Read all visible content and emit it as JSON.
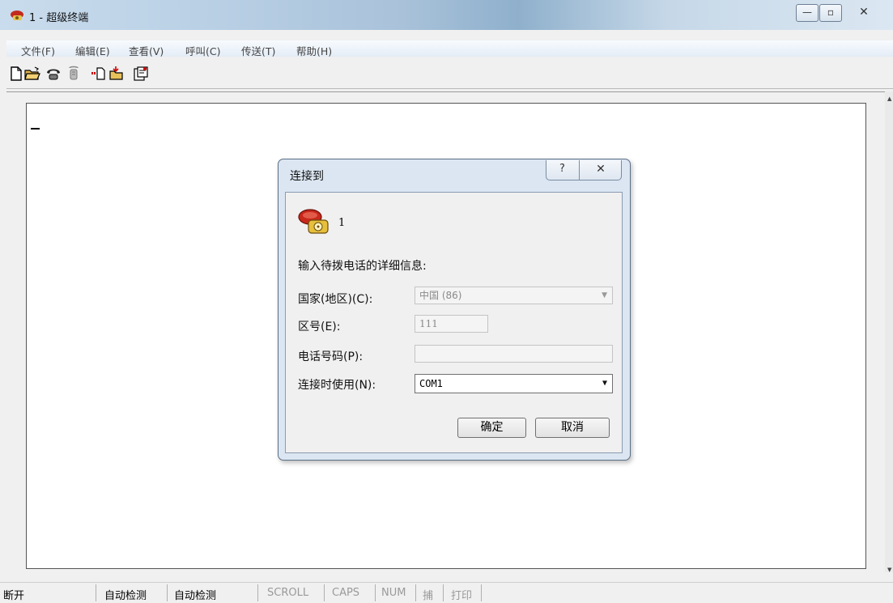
{
  "window": {
    "title": "1 - 超级终端"
  },
  "menu": [
    "文件(F)",
    "编辑(E)",
    "查看(V)",
    "呼叫(C)",
    "传送(T)",
    "帮助(H)"
  ],
  "toolbar_icons": [
    "new-icon",
    "open-icon",
    "dial-icon",
    "hangup-icon",
    "send-icon",
    "receive-icon",
    "properties-icon"
  ],
  "dialog": {
    "title": "连接到",
    "help_glyph": "?",
    "close_glyph": "✕",
    "connection_name": "1",
    "prompt": "输入待拨电话的详细信息:",
    "country_label": "国家(地区)(C):",
    "country_value": "中国 (86)",
    "area_label": "区号(E):",
    "area_value": "111",
    "phone_label": "电话号码(P):",
    "phone_value": "",
    "connect_using_label": "连接时使用(N):",
    "connect_using_value": "COM1",
    "ok_label": "确定",
    "cancel_label": "取消"
  },
  "status": {
    "state": "断开",
    "detect1": "自动检测",
    "detect2": "自动检测",
    "scroll": "SCROLL",
    "caps": "CAPS",
    "num": "NUM",
    "capture": "捕",
    "print": "打印"
  },
  "colors": {
    "dialog_frame": "#dbe6f2",
    "titlebar": "#a9c2da"
  }
}
